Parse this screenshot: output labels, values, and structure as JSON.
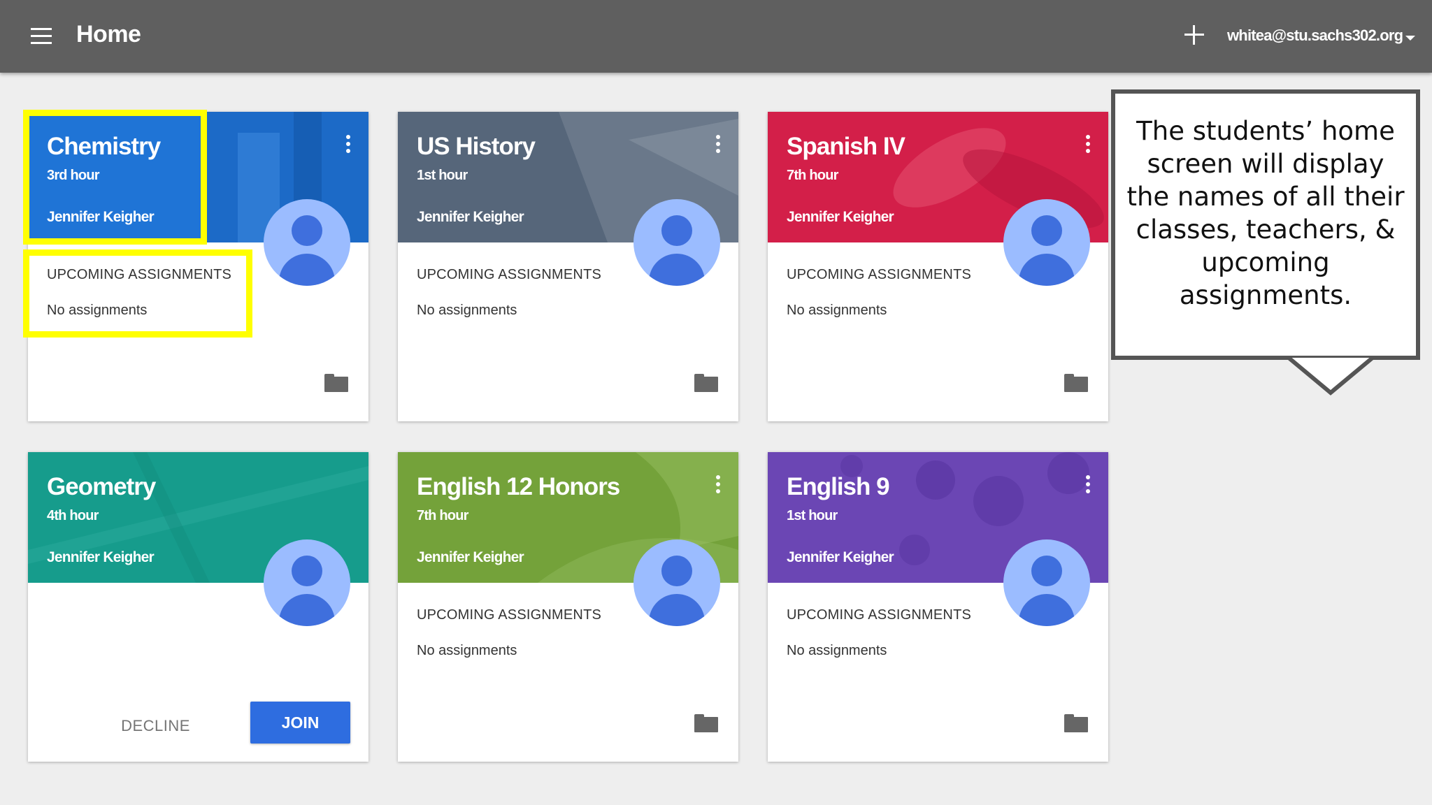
{
  "topbar": {
    "title": "Home",
    "account_email": "whitea@stu.sachs302.org"
  },
  "upcoming_label": "UPCOMING ASSIGNMENTS",
  "no_assignments": "No assignments",
  "classes": [
    {
      "name": "Chemistry",
      "section": "3rd hour",
      "teacher": "Jennifer Keigher",
      "color": "#1f74d6"
    },
    {
      "name": "US History",
      "section": "1st hour",
      "teacher": "Jennifer Keigher",
      "color": "#56667a"
    },
    {
      "name": "Spanish IV",
      "section": "7th hour",
      "teacher": "Jennifer Keigher",
      "color": "#d31f49"
    },
    {
      "name": "Geometry",
      "section": "4th hour",
      "teacher": "Jennifer Keigher",
      "color": "#169c8c"
    },
    {
      "name": "English 12 Honors",
      "section": "7th hour",
      "teacher": "Jennifer Keigher",
      "color": "#74a23a"
    },
    {
      "name": "English 9",
      "section": "1st hour",
      "teacher": "Jennifer Keigher",
      "color": "#6b46b4"
    }
  ],
  "invite": {
    "decline_label": "DECLINE",
    "join_label": "JOIN"
  },
  "callout": {
    "text": "The students’ home screen will display the names of all their classes, teachers, & upcoming assignments."
  },
  "highlight_color": "#ffff00",
  "icons": {
    "menu": "hamburger-menu-icon",
    "add": "plus-icon",
    "account_dropdown": "caret-down-icon",
    "class_options": "more-vert-icon",
    "class_folder": "folder-icon",
    "teacher_avatar": "person-avatar-icon"
  }
}
